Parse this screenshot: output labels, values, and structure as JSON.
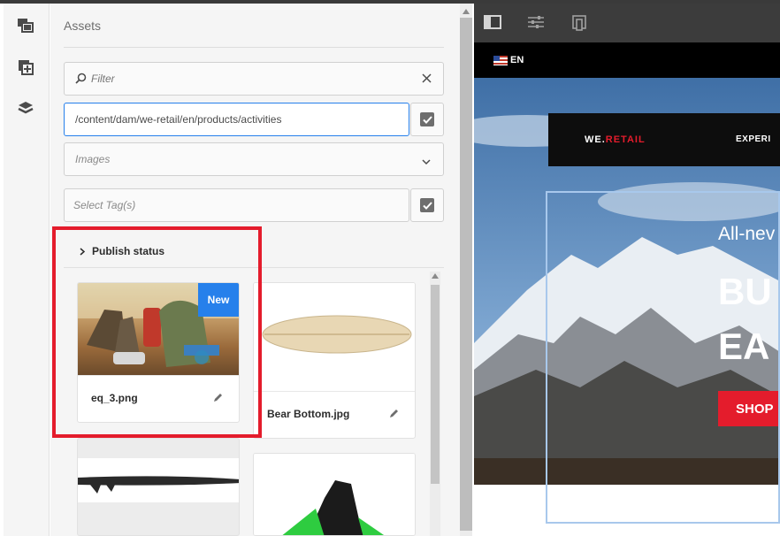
{
  "colors": {
    "accent": "#2680eb",
    "highlight": "#e41c2c",
    "brand_red": "#e41c2c"
  },
  "rail": {
    "icons": [
      "assets-icon",
      "components-icon",
      "layers-icon"
    ]
  },
  "panel": {
    "title": "Assets",
    "filter": {
      "placeholder": "Filter",
      "value": ""
    },
    "path": {
      "value": "/content/dam/we-retail/en/products/activities"
    },
    "type_select": {
      "selected": "Images"
    },
    "tags": {
      "placeholder": "Select Tag(s)"
    },
    "publish_status": {
      "label": "Publish status"
    }
  },
  "assets": [
    {
      "name": "eq_3.png",
      "badge": "New"
    },
    {
      "name": "Bear Bottom.jpg",
      "badge": ""
    },
    {
      "name": "",
      "badge": ""
    },
    {
      "name": "",
      "badge": ""
    }
  ],
  "editor": {
    "toolbar_icons": [
      "side-panel-icon",
      "properties-icon",
      "emulator-icon"
    ],
    "site": {
      "language": "EN",
      "brand_part1": "WE.",
      "brand_part2": "RETAIL",
      "nav_item": "EXPERI",
      "hero_line1": "All-nev",
      "hero_line2": "BU",
      "hero_line3": "EA",
      "cta": "SHOP"
    }
  }
}
